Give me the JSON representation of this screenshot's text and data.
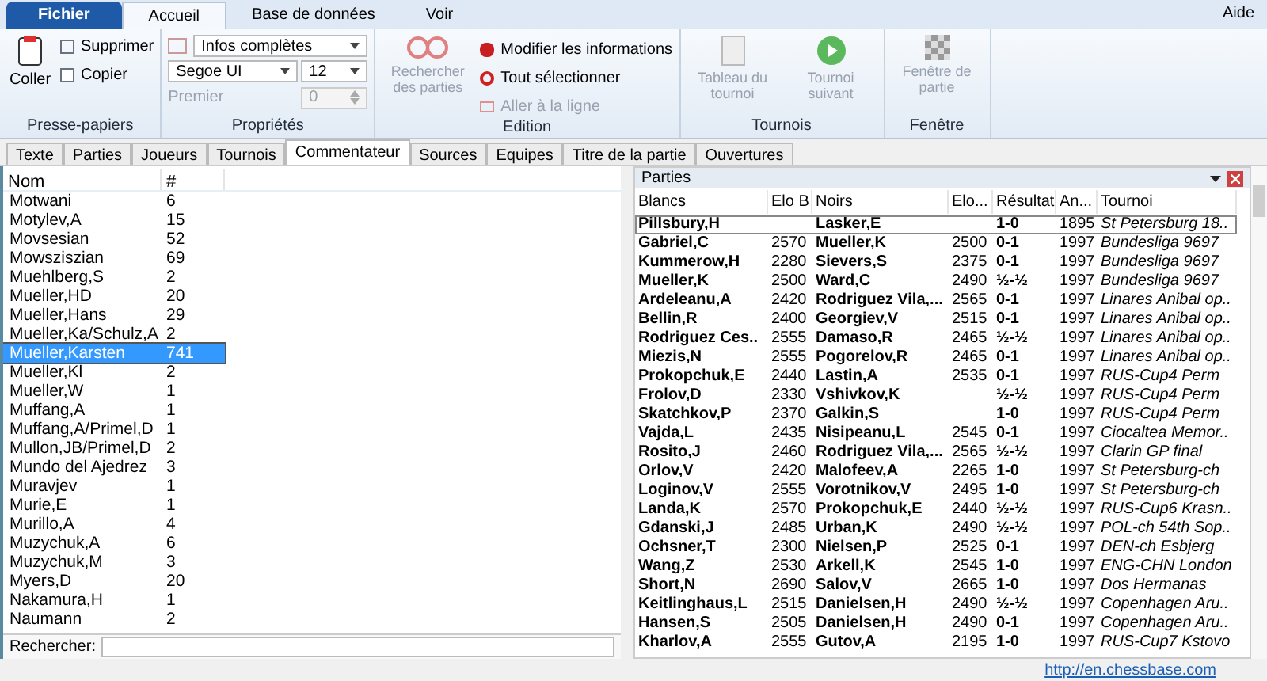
{
  "menu": {
    "file": "Fichier",
    "tabs": [
      {
        "label": "Accueil",
        "selected": true
      },
      {
        "label": "Base de données",
        "selected": false
      },
      {
        "label": "Voir",
        "selected": false
      }
    ],
    "help": "Aide"
  },
  "ribbon": {
    "groups": [
      {
        "title": "Presse-papiers",
        "coller": "Coller",
        "supprimer": "Supprimer",
        "copier": "Copier"
      },
      {
        "title": "Propriétés",
        "info": "Infos complètes",
        "font": "Segoe UI",
        "size": "12",
        "premier": "Premier",
        "premier_value": "0"
      },
      {
        "title": "Edition",
        "search": "Rechercher des parties",
        "modify": "Modifier les informations",
        "select_all": "Tout sélectionner",
        "goto": "Aller à la ligne"
      },
      {
        "title": "Tournois",
        "table": "Tableau du tournoi",
        "next": "Tournoi suivant"
      },
      {
        "title": "Fenêtre",
        "window": "Fenêtre de partie"
      }
    ]
  },
  "doc_tabs": [
    {
      "label": "Texte",
      "selected": false
    },
    {
      "label": "Parties",
      "selected": false
    },
    {
      "label": "Joueurs",
      "selected": false
    },
    {
      "label": "Tournois",
      "selected": false
    },
    {
      "label": "Commentateur",
      "selected": true
    },
    {
      "label": "Sources",
      "selected": false
    },
    {
      "label": "Equipes",
      "selected": false
    },
    {
      "label": "Titre de la partie",
      "selected": false
    },
    {
      "label": "Ouvertures",
      "selected": false
    }
  ],
  "annotators": {
    "columns": [
      "Nom",
      "#"
    ],
    "rows": [
      {
        "name": "Motwani",
        "count": "6",
        "selected": false
      },
      {
        "name": "Motylev,A",
        "count": "15",
        "selected": false
      },
      {
        "name": "Movsesian",
        "count": "52",
        "selected": false
      },
      {
        "name": "Mowsziszian",
        "count": "69",
        "selected": false
      },
      {
        "name": "Muehlberg,S",
        "count": "2",
        "selected": false
      },
      {
        "name": "Mueller,HD",
        "count": "20",
        "selected": false
      },
      {
        "name": "Mueller,Hans",
        "count": "29",
        "selected": false
      },
      {
        "name": "Mueller,Ka/Schulz,A",
        "count": "2",
        "selected": false
      },
      {
        "name": "Mueller,Karsten",
        "count": "741",
        "selected": true
      },
      {
        "name": "Mueller,Kl",
        "count": "2",
        "selected": false
      },
      {
        "name": "Mueller,W",
        "count": "1",
        "selected": false
      },
      {
        "name": "Muffang,A",
        "count": "1",
        "selected": false
      },
      {
        "name": "Muffang,A/Primel,D",
        "count": "1",
        "selected": false
      },
      {
        "name": "Mullon,JB/Primel,D",
        "count": "2",
        "selected": false
      },
      {
        "name": "Mundo del Ajedrez",
        "count": "3",
        "selected": false
      },
      {
        "name": "Muravjev",
        "count": "1",
        "selected": false
      },
      {
        "name": "Murie,E",
        "count": "1",
        "selected": false
      },
      {
        "name": "Murillo,A",
        "count": "4",
        "selected": false
      },
      {
        "name": "Muzychuk,A",
        "count": "6",
        "selected": false
      },
      {
        "name": "Muzychuk,M",
        "count": "3",
        "selected": false
      },
      {
        "name": "Myers,D",
        "count": "20",
        "selected": false
      },
      {
        "name": "Nakamura,H",
        "count": "1",
        "selected": false
      },
      {
        "name": "Naumann",
        "count": "2",
        "selected": false
      }
    ],
    "search_label": "Rechercher:"
  },
  "games": {
    "title": "Parties",
    "columns": [
      "Blancs",
      "Elo B",
      "Noirs",
      "Elo...",
      "Résultat",
      "An...",
      "Tournoi"
    ],
    "rows": [
      {
        "white": "Pillsbury,H",
        "black": "Lasker,E",
        "result": "1-0",
        "year": "1895",
        "event": "St Petersburg 18..",
        "selected": true
      },
      {
        "white": "Gabriel,C",
        "elo_w": "2570",
        "black": "Mueller,K",
        "elo_b": "2500",
        "result": "0-1",
        "year": "1997",
        "event": "Bundesliga 9697",
        "selected": false
      },
      {
        "white": "Kummerow,H",
        "elo_w": "2280",
        "black": "Sievers,S",
        "elo_b": "2375",
        "result": "0-1",
        "year": "1997",
        "event": "Bundesliga 9697",
        "selected": false
      },
      {
        "white": "Mueller,K",
        "elo_w": "2500",
        "black": "Ward,C",
        "elo_b": "2490",
        "result": "½-½",
        "year": "1997",
        "event": "Bundesliga 9697",
        "selected": false
      },
      {
        "white": "Ardeleanu,A",
        "elo_w": "2420",
        "black": "Rodriguez Vila,...",
        "elo_b": "2565",
        "result": "0-1",
        "year": "1997",
        "event": "Linares Anibal op..",
        "selected": false
      },
      {
        "white": "Bellin,R",
        "elo_w": "2400",
        "black": "Georgiev,V",
        "elo_b": "2515",
        "result": "0-1",
        "year": "1997",
        "event": "Linares Anibal op..",
        "selected": false
      },
      {
        "white": "Rodriguez Ces..",
        "elo_w": "2555",
        "black": "Damaso,R",
        "elo_b": "2465",
        "result": "½-½",
        "year": "1997",
        "event": "Linares Anibal op..",
        "selected": false
      },
      {
        "white": "Miezis,N",
        "elo_w": "2555",
        "black": "Pogorelov,R",
        "elo_b": "2465",
        "result": "0-1",
        "year": "1997",
        "event": "Linares Anibal op..",
        "selected": false
      },
      {
        "white": "Prokopchuk,E",
        "elo_w": "2440",
        "black": "Lastin,A",
        "elo_b": "2535",
        "result": "0-1",
        "year": "1997",
        "event": "RUS-Cup4 Perm",
        "selected": false
      },
      {
        "white": "Frolov,D",
        "elo_w": "2330",
        "black": "Vshivkov,K",
        "result": "½-½",
        "year": "1997",
        "event": "RUS-Cup4 Perm",
        "selected": false
      },
      {
        "white": "Skatchkov,P",
        "elo_w": "2370",
        "black": "Galkin,S",
        "result": "1-0",
        "year": "1997",
        "event": "RUS-Cup4 Perm",
        "selected": false
      },
      {
        "white": "Vajda,L",
        "elo_w": "2435",
        "black": "Nisipeanu,L",
        "elo_b": "2545",
        "result": "0-1",
        "year": "1997",
        "event": "Ciocaltea Memor..",
        "selected": false
      },
      {
        "white": "Rosito,J",
        "elo_w": "2460",
        "black": "Rodriguez Vila,...",
        "elo_b": "2565",
        "result": "½-½",
        "year": "1997",
        "event": "Clarin GP final",
        "selected": false
      },
      {
        "white": "Orlov,V",
        "elo_w": "2420",
        "black": "Malofeev,A",
        "elo_b": "2265",
        "result": "1-0",
        "year": "1997",
        "event": "St Petersburg-ch",
        "selected": false
      },
      {
        "white": "Loginov,V",
        "elo_w": "2555",
        "black": "Vorotnikov,V",
        "elo_b": "2495",
        "result": "1-0",
        "year": "1997",
        "event": "St Petersburg-ch",
        "selected": false
      },
      {
        "white": "Landa,K",
        "elo_w": "2570",
        "black": "Prokopchuk,E",
        "elo_b": "2440",
        "result": "½-½",
        "year": "1997",
        "event": "RUS-Cup6 Krasn..",
        "selected": false
      },
      {
        "white": "Gdanski,J",
        "elo_w": "2485",
        "black": "Urban,K",
        "elo_b": "2490",
        "result": "½-½",
        "year": "1997",
        "event": "POL-ch 54th Sop..",
        "selected": false
      },
      {
        "white": "Ochsner,T",
        "elo_w": "2300",
        "black": "Nielsen,P",
        "elo_b": "2525",
        "result": "0-1",
        "year": "1997",
        "event": "DEN-ch Esbjerg",
        "selected": false
      },
      {
        "white": "Wang,Z",
        "elo_w": "2530",
        "black": "Arkell,K",
        "elo_b": "2545",
        "result": "1-0",
        "year": "1997",
        "event": "ENG-CHN London",
        "selected": false
      },
      {
        "white": "Short,N",
        "elo_w": "2690",
        "black": "Salov,V",
        "elo_b": "2665",
        "result": "1-0",
        "year": "1997",
        "event": "Dos Hermanas",
        "selected": false
      },
      {
        "white": "Keitlinghaus,L",
        "elo_w": "2515",
        "black": "Danielsen,H",
        "elo_b": "2490",
        "result": "½-½",
        "year": "1997",
        "event": "Copenhagen Aru..",
        "selected": false
      },
      {
        "white": "Hansen,S",
        "elo_w": "2505",
        "black": "Danielsen,H",
        "elo_b": "2490",
        "result": "0-1",
        "year": "1997",
        "event": "Copenhagen Aru..",
        "selected": false
      },
      {
        "white": "Kharlov,A",
        "elo_w": "2555",
        "black": "Gutov,A",
        "elo_b": "2195",
        "result": "1-0",
        "year": "1997",
        "event": "RUS-Cup7 Kstovo",
        "selected": false
      }
    ]
  },
  "status": {
    "link": "http://en.chessbase.com"
  }
}
